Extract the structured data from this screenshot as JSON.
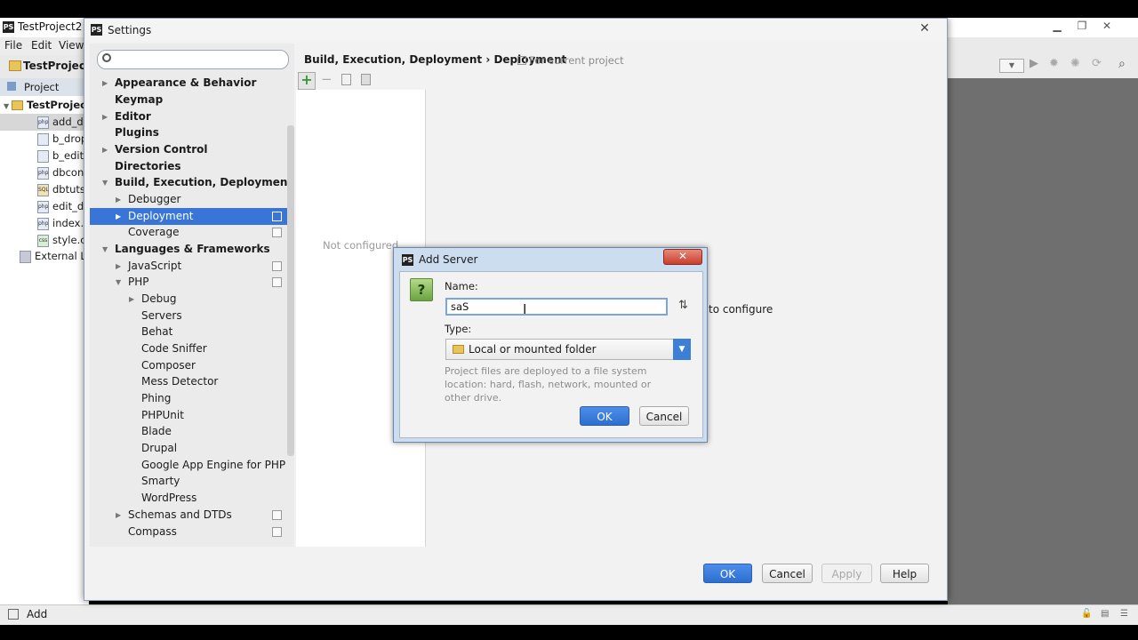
{
  "ide": {
    "title": "TestProject2 -",
    "menu": [
      "File",
      "Edit",
      "View"
    ],
    "crumb": "TestProject2",
    "project_tab": "Project",
    "tree": [
      {
        "label": "TestProjec",
        "bold": true
      },
      {
        "label": "add_da"
      },
      {
        "label": "b_drop."
      },
      {
        "label": "b_edit.p"
      },
      {
        "label": "dbconf"
      },
      {
        "label": "dbtuts.s"
      },
      {
        "label": "edit_da"
      },
      {
        "label": "index.p"
      },
      {
        "label": "style.cs"
      },
      {
        "label": "External Lib"
      }
    ],
    "status": "Add"
  },
  "settings": {
    "title": "Settings",
    "search": {
      "placeholder": "",
      "value": ""
    },
    "nav": [
      {
        "label": "Appearance & Behavior"
      },
      {
        "label": "Keymap"
      },
      {
        "label": "Editor"
      },
      {
        "label": "Plugins"
      },
      {
        "label": "Version Control"
      },
      {
        "label": "Directories"
      },
      {
        "label": "Build, Execution, Deployment"
      },
      {
        "label": "Debugger"
      },
      {
        "label": "Deployment"
      },
      {
        "label": "Coverage"
      },
      {
        "label": "Languages & Frameworks"
      },
      {
        "label": "JavaScript"
      },
      {
        "label": "PHP"
      },
      {
        "label": "Debug"
      },
      {
        "label": "Servers"
      },
      {
        "label": "Behat"
      },
      {
        "label": "Code Sniffer"
      },
      {
        "label": "Composer"
      },
      {
        "label": "Mess Detector"
      },
      {
        "label": "Phing"
      },
      {
        "label": "PHPUnit"
      },
      {
        "label": "Blade"
      },
      {
        "label": "Drupal"
      },
      {
        "label": "Google App Engine for PHP"
      },
      {
        "label": "Smarty"
      },
      {
        "label": "WordPress"
      },
      {
        "label": "Schemas and DTDs"
      },
      {
        "label": "Compass"
      }
    ],
    "breadcrumb": "Build, Execution, Deployment › Deployment",
    "breadcrumb_note": "For current project",
    "list_empty": "Not configured",
    "hint": "to configure",
    "buttons": {
      "ok": "OK",
      "cancel": "Cancel",
      "apply": "Apply",
      "help": "Help"
    }
  },
  "add_server": {
    "title": "Add Server",
    "name_label": "Name:",
    "name_value": "saS",
    "type_label": "Type:",
    "type_value": "Local or mounted folder",
    "type_description": "Project files are deployed to a file system location: hard, flash, network, mounted or other drive.",
    "ok": "OK",
    "cancel": "Cancel"
  },
  "colors": {
    "accent": "#3875d7",
    "primary_button": "#2d6fd0"
  },
  "icons": [
    "search-icon",
    "add-icon",
    "remove-icon",
    "copy-icon",
    "question-icon",
    "folder-icon",
    "chevron-down-icon",
    "sort-icon",
    "close-icon"
  ]
}
